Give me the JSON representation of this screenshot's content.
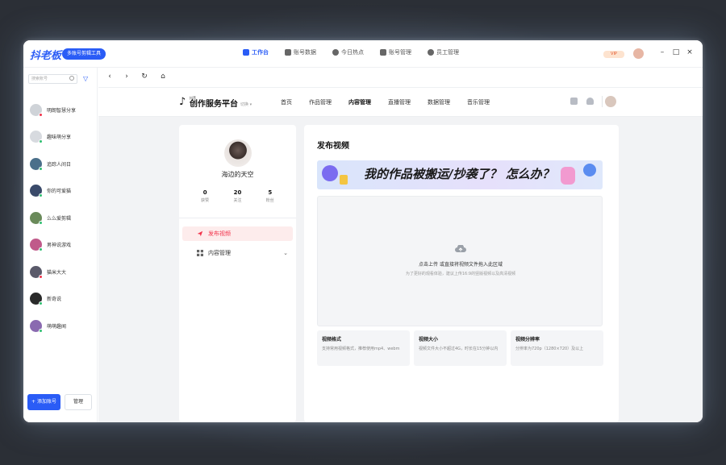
{
  "app": {
    "logo": "抖老板",
    "badge": "多账号剪辑工具"
  },
  "topnav": [
    {
      "label": "工作台",
      "icon": "grid-icon",
      "active": true
    },
    {
      "label": "账号数据",
      "icon": "chart-icon",
      "active": false
    },
    {
      "label": "今日热点",
      "icon": "fire-icon",
      "active": false
    },
    {
      "label": "账号管理",
      "icon": "id-card-icon",
      "active": false
    },
    {
      "label": "员工管理",
      "icon": "user-icon",
      "active": false
    }
  ],
  "titlebar": {
    "vip": "VIP",
    "min": "–",
    "max": "□",
    "close": "×"
  },
  "sidebar": {
    "search_placeholder": "搜索账号",
    "accounts": [
      {
        "name": "明朗智慧分享",
        "color": "#cfd3d8",
        "status": "#f2324a"
      },
      {
        "name": "趣味萌分享",
        "color": "#d7dadf",
        "status": "#2fbf71"
      },
      {
        "name": "追踪人间日",
        "color": "#4a6f8a",
        "status": "#2fbf71"
      },
      {
        "name": "你的可爱猫",
        "color": "#3a4a6a",
        "status": "#2fbf71"
      },
      {
        "name": "么么爱剪辑",
        "color": "#6a8a5a",
        "status": "#2fbf71"
      },
      {
        "name": "男神说游戏",
        "color": "#c05a8a",
        "status": "#2fbf71"
      },
      {
        "name": "猫米大大",
        "color": "#5a5a6a",
        "status": "#f2324a"
      },
      {
        "name": "新奇说",
        "color": "#2a2a2a",
        "status": "#2fbf71"
      },
      {
        "name": "萌萌趣闻",
        "color": "#8a6ab0",
        "status": "#2fbf71"
      }
    ],
    "add_label": "+ 添加账号",
    "manage_label": "管理"
  },
  "toolbar": {
    "back": "‹",
    "forward": "›",
    "refresh": "↻",
    "home": "⌂"
  },
  "site": {
    "small_label": "抖音",
    "title": "创作服务平台",
    "version": "切换 ▾",
    "nav": [
      {
        "label": "首页",
        "active": false
      },
      {
        "label": "作品管理",
        "active": false
      },
      {
        "label": "内容管理",
        "active": true
      },
      {
        "label": "直播管理",
        "active": false
      },
      {
        "label": "数据管理",
        "active": false
      },
      {
        "label": "音乐管理",
        "active": false
      }
    ]
  },
  "profile": {
    "name": "海边的天空",
    "stats": [
      {
        "value": "0",
        "label": "获赞"
      },
      {
        "value": "20",
        "label": "关注"
      },
      {
        "value": "5",
        "label": "粉丝"
      }
    ]
  },
  "menu": [
    {
      "label": "发布视频",
      "active": true
    },
    {
      "label": "内容管理",
      "active": false
    }
  ],
  "publish": {
    "title": "发布视频",
    "banner": "我的作品被搬运/抄袭了？ 怎么办？",
    "upload_main": "点击上传 或直接将视频文件拖入此区域",
    "upload_sub": "为了更好的观看体验，建议上传16:9的竖版视频以及高清视频",
    "cards": [
      {
        "title": "视频格式",
        "desc": "支持常用视频格式，推荐使用mp4、webm"
      },
      {
        "title": "视频大小",
        "desc": "视频文件大小不超过4G，时长在15分钟以内"
      },
      {
        "title": "视频分辨率",
        "desc": "分辨率为720p（1280×720）及以上"
      }
    ]
  }
}
